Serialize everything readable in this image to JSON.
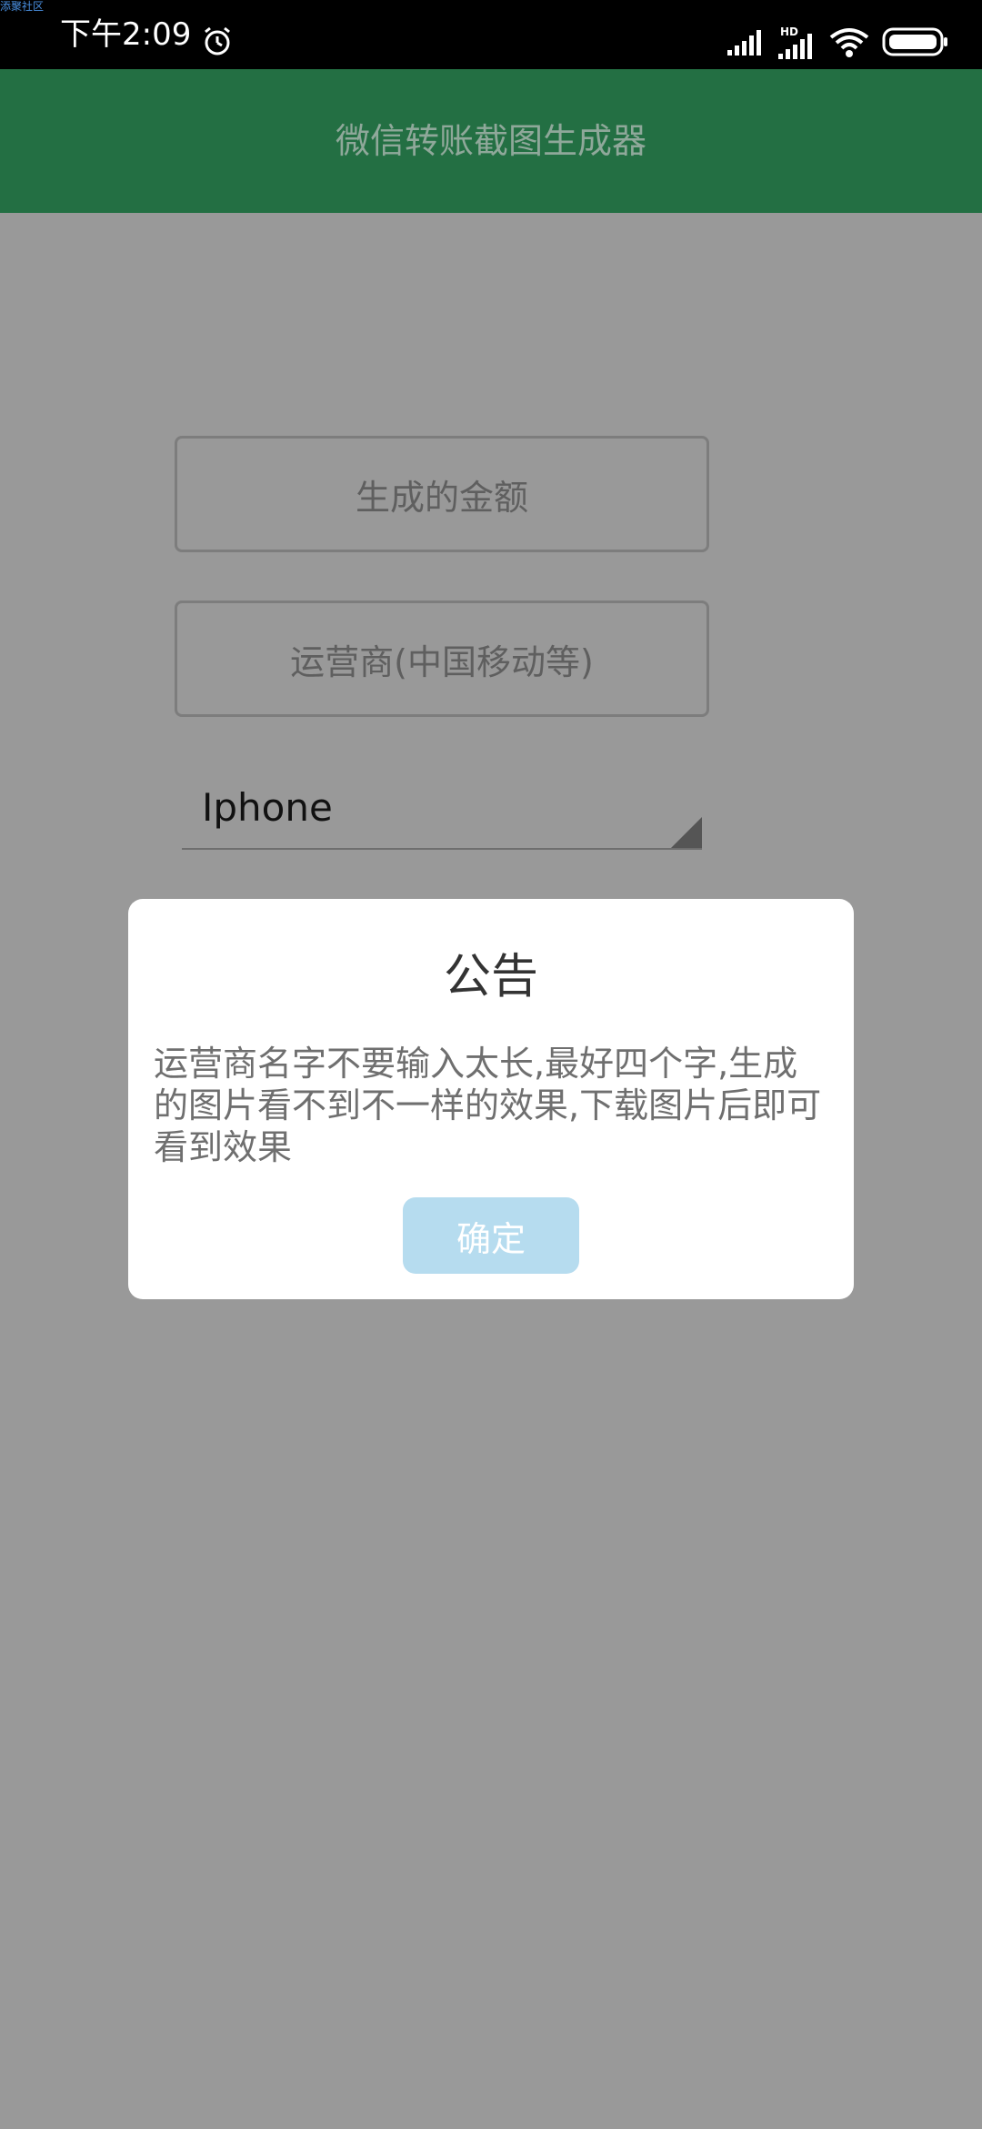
{
  "status_bar": {
    "watermark": "添聚社区",
    "time": "下午2:09",
    "icons": [
      "alarm-icon",
      "signal-icon",
      "hd-signal-icon",
      "wifi-icon",
      "battery-icon"
    ],
    "hd_label": "HD"
  },
  "app_bar": {
    "title": "微信转账截图生成器",
    "color": "#236f43"
  },
  "form": {
    "amount_placeholder": "生成的金额",
    "carrier_placeholder": "运营商(中国移动等)",
    "device_select_value": "Iphone"
  },
  "dialog": {
    "title": "公告",
    "message": "运营商名字不要输入太长,最好四个字,生成的图片看不到不一样的效果,下载图片后即可看到效果",
    "confirm_label": "确定",
    "button_color": "#b6dcef"
  }
}
